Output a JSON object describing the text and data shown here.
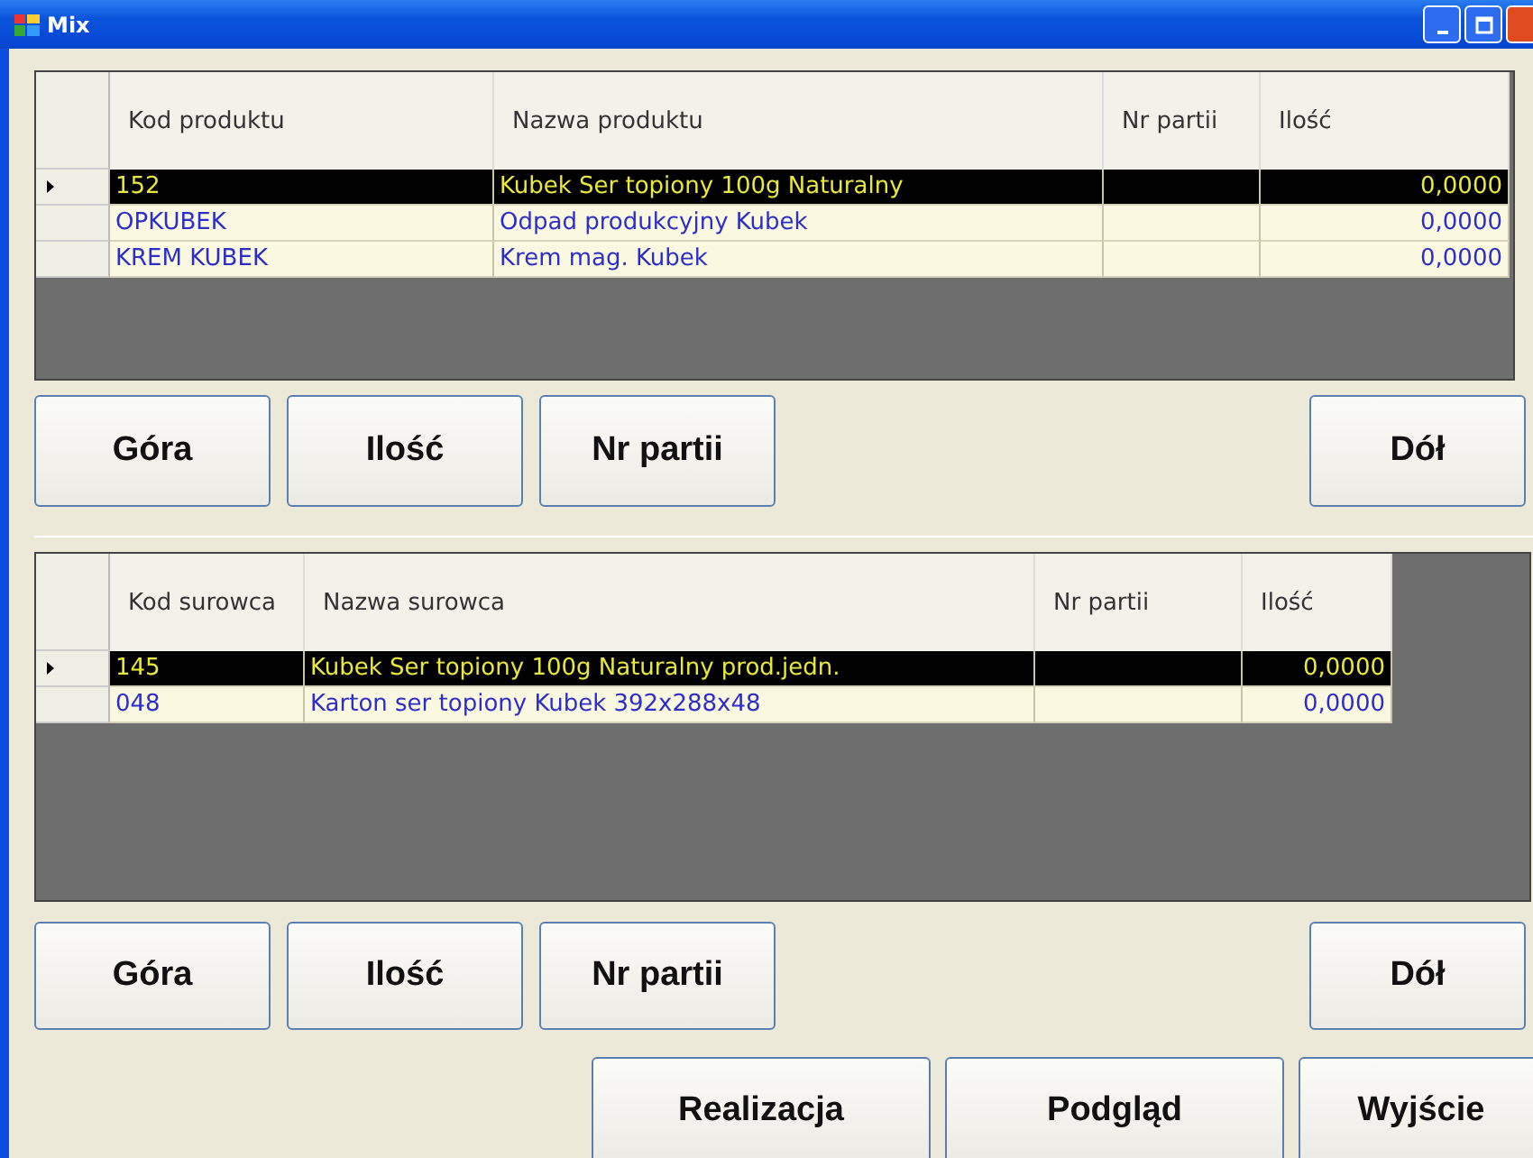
{
  "window": {
    "title": "Mix"
  },
  "products": {
    "columns": [
      "Kod produktu",
      "Nazwa produktu",
      "Nr partii",
      "Ilość"
    ],
    "rows": [
      {
        "cells": [
          "152",
          "Kubek Ser topiony 100g Naturalny",
          "",
          "0,0000"
        ],
        "selected": true
      },
      {
        "cells": [
          "OPKUBEK",
          "Odpad produkcyjny Kubek",
          "",
          "0,0000"
        ],
        "selected": false
      },
      {
        "cells": [
          "KREM KUBEK",
          "Krem mag. Kubek",
          "",
          "0,0000"
        ],
        "selected": false
      }
    ]
  },
  "products_buttons": [
    "Góra",
    "Ilość",
    "Nr partii",
    "Dół"
  ],
  "materials": {
    "columns": [
      "Kod surowca",
      "Nazwa surowca",
      "Nr partii",
      "Ilość"
    ],
    "rows": [
      {
        "cells": [
          "145",
          "Kubek Ser topiony 100g Naturalny prod.jedn.",
          "",
          "0,0000"
        ],
        "selected": true
      },
      {
        "cells": [
          "048",
          "Karton ser topiony Kubek 392x288x48",
          "",
          "0,0000"
        ],
        "selected": false
      }
    ]
  },
  "materials_buttons": [
    "Góra",
    "Ilość",
    "Nr partii",
    "Dół"
  ],
  "footer_buttons": [
    "Realizacja",
    "Podgląd",
    "Wyjście"
  ]
}
